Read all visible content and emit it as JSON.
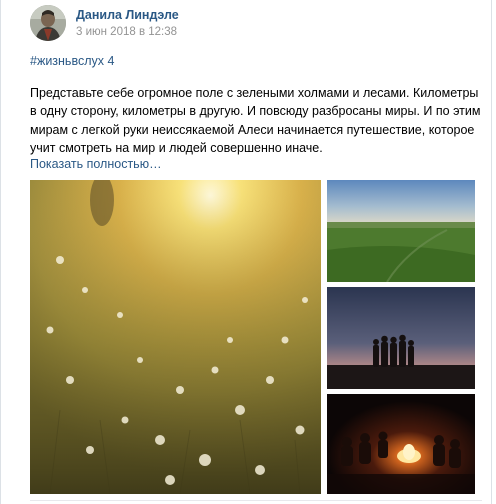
{
  "post": {
    "author": "Данила Линдэле",
    "date": "3 июн 2018 в 12:38",
    "hashtag": "#жизньвслух 4",
    "text": "Представьте себе огромное поле с зелеными холмами и лесами. Километры в одну сторону, километры в другую. И повсюду разбросаны миры. И по этим мирам с легкой руки неиссякаемой Алеси начинается путешествие, которое учит смотреть на мир и людей совершенно иначе.",
    "show_more": "Показать полностью…"
  },
  "photos": [
    {
      "subject": "sunlit meadow with dandelions"
    },
    {
      "subject": "green field at dusk"
    },
    {
      "subject": "silhouettes of people against twilight sky"
    },
    {
      "subject": "people around campfire at night"
    }
  ],
  "colors": {
    "link": "#2a5885",
    "muted": "#939393"
  }
}
